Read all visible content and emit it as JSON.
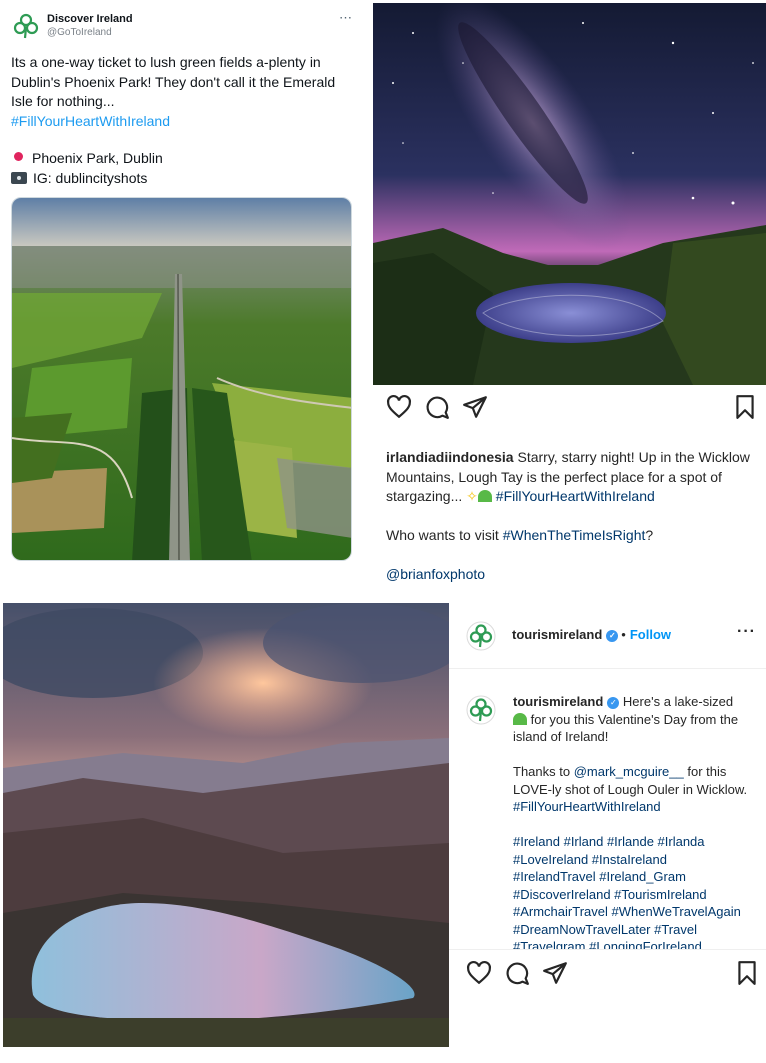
{
  "tweet": {
    "account_name": "Discover Ireland",
    "handle": "@GoToIreland",
    "more_icon": "⋯",
    "text": "Its a one-way ticket to lush green fields a-plenty in Dublin's Phoenix Park! They don't call it the Emerald Isle for nothing...",
    "hashtag": "#FillYourHeartWithIreland",
    "location": "Phoenix Park, Dublin",
    "credit": "IG: dublincityshots"
  },
  "ig_post_1": {
    "username": "irlandiadiindonesia",
    "caption": "Starry, starry night! Up in the Wicklow Mountains, Lough Tay is the perfect place for a spot of stargazing...",
    "hashtag": "#FillYourHeartWithIreland",
    "question_prefix": "Who wants to visit",
    "question_hashtag": "#WhenTheTimeIsRight",
    "question_suffix": "?",
    "photo_credit": "@brianfoxphoto"
  },
  "ig_post_2": {
    "username": "tourismireland",
    "follow_label": "Follow",
    "dot": "•",
    "more_icon": "···",
    "comment_intro": "Here's a lake-sized",
    "comment_intro2": "for you this Valentine's Day from the island of Ireland!",
    "thanks_prefix": "Thanks to",
    "mention": "@mark_mcguire__",
    "thanks_suffix": "for this LOVE-ly shot of Lough Ouler in Wicklow.",
    "thanks_hashtag": "#FillYourHeartWithIreland",
    "hashtags": [
      "#Ireland #Irland #Irlande #Irlanda",
      "#LoveIreland #InstaIreland",
      "#IrelandTravel #Ireland_Gram",
      "#DiscoverIreland #TourismIreland",
      "#ArmchairTravel #WhenWeTravelAgain",
      "#DreamNowTravelLater #Travel",
      "#Travelgram #LongingForIreland"
    ]
  },
  "colors": {
    "shamrock_green": "#2e9b54",
    "link_blue": "#1d9bf0",
    "ig_link": "#00376b",
    "ig_follow": "#0095f6"
  },
  "icons": {
    "like": "heart-icon",
    "comment": "comment-icon",
    "share": "paper-plane-icon",
    "save": "bookmark-icon"
  }
}
